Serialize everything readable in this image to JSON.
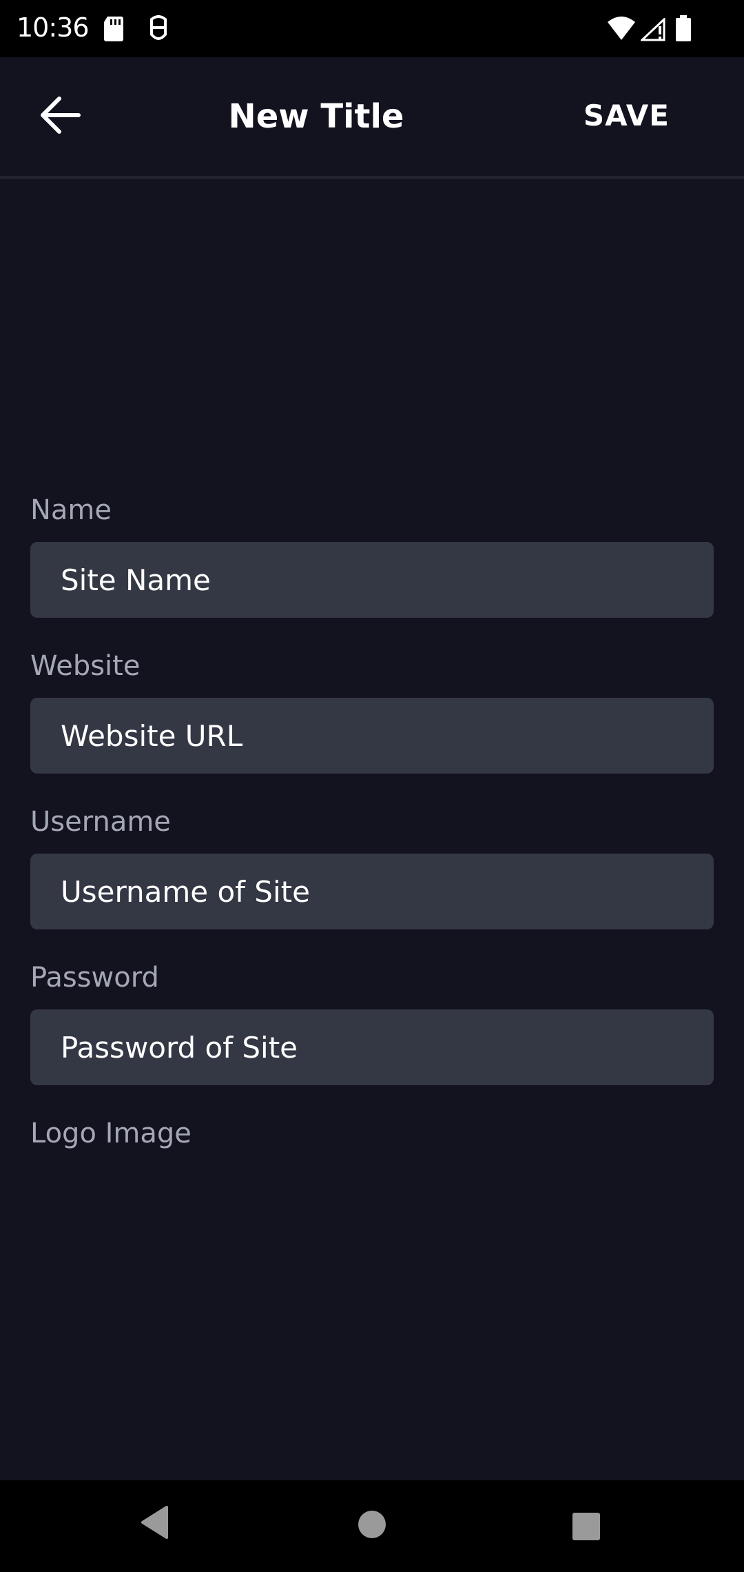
{
  "status_bar": {
    "time": "10:36",
    "icons": [
      "sd-card-icon",
      "face-icon",
      "wifi-icon",
      "signal-icon",
      "battery-icon"
    ]
  },
  "app_bar": {
    "title": "New Title",
    "save_label": "SAVE",
    "back_icon": "arrow-left-icon"
  },
  "form": {
    "name": {
      "label": "Name",
      "placeholder": "Site Name"
    },
    "website": {
      "label": "Website",
      "placeholder": "Website URL"
    },
    "username": {
      "label": "Username",
      "placeholder": "Username of Site"
    },
    "password": {
      "label": "Password",
      "placeholder": "Password of Site"
    },
    "logo_label": "Logo Image"
  },
  "nav_bar": {
    "icons": [
      "back-triangle-icon",
      "home-circle-icon",
      "recents-square-icon"
    ]
  },
  "colors": {
    "background": "#13121f",
    "field_bg": "#343744",
    "label": "#a4a7b4",
    "text": "#ffffff"
  }
}
